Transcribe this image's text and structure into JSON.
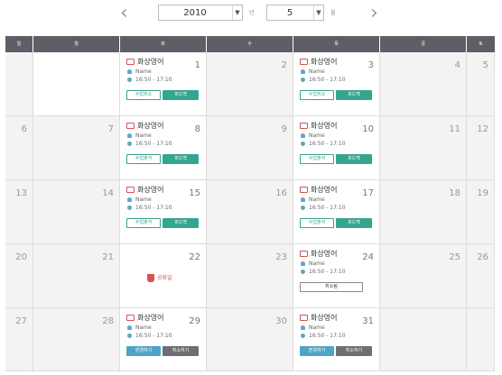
{
  "nav": {
    "prev_icon": "‹",
    "next_icon": "›"
  },
  "year_select": {
    "value": "2010",
    "unit": "년"
  },
  "month_select": {
    "value": "5",
    "unit": "월"
  },
  "weekdays": [
    "일",
    "월",
    "화",
    "수",
    "목",
    "금",
    "토"
  ],
  "rows": [
    {
      "days": [
        {
          "num": "",
          "gray": true
        },
        {
          "num": "",
          "gray": false
        },
        {
          "num": "1",
          "gray": false,
          "lesson": {
            "title": "화상영어",
            "teacher": "Name",
            "time": "16:50 - 17:10",
            "buttons": [
              {
                "label": "수업취소",
                "style": "outline"
              },
              {
                "label": "피드백",
                "style": "teal"
              }
            ]
          }
        },
        {
          "num": "2",
          "gray": true
        },
        {
          "num": "3",
          "gray": false,
          "lesson": {
            "title": "화상영어",
            "teacher": "Name",
            "time": "16:50 - 17:10",
            "buttons": [
              {
                "label": "수업취소",
                "style": "outline"
              },
              {
                "label": "피드백",
                "style": "teal"
              }
            ]
          }
        },
        {
          "num": "4",
          "gray": true
        },
        {
          "num": "5",
          "gray": true
        }
      ]
    },
    {
      "days": [
        {
          "num": "6",
          "gray": true
        },
        {
          "num": "7",
          "gray": true
        },
        {
          "num": "8",
          "gray": false,
          "lesson": {
            "title": "화상영어",
            "teacher": "Name",
            "time": "16:50 - 17:10",
            "buttons": [
              {
                "label": "수업출석",
                "style": "outline"
              },
              {
                "label": "피드백",
                "style": "teal"
              }
            ]
          }
        },
        {
          "num": "9",
          "gray": true
        },
        {
          "num": "10",
          "gray": false,
          "lesson": {
            "title": "화상영어",
            "teacher": "Name",
            "time": "16:50 - 17:10",
            "buttons": [
              {
                "label": "수업출석",
                "style": "outline"
              },
              {
                "label": "피드백",
                "style": "teal"
              }
            ]
          }
        },
        {
          "num": "11",
          "gray": true
        },
        {
          "num": "12",
          "gray": true
        }
      ]
    },
    {
      "days": [
        {
          "num": "13",
          "gray": true
        },
        {
          "num": "14",
          "gray": true
        },
        {
          "num": "15",
          "gray": false,
          "lesson": {
            "title": "화상영어",
            "teacher": "Name",
            "time": "16:50 - 17:10",
            "buttons": [
              {
                "label": "수업출석",
                "style": "outline"
              },
              {
                "label": "피드백",
                "style": "teal"
              }
            ]
          }
        },
        {
          "num": "16",
          "gray": true
        },
        {
          "num": "17",
          "gray": false,
          "lesson": {
            "title": "화상영어",
            "teacher": "Name",
            "time": "16:50 - 17:10",
            "buttons": [
              {
                "label": "수업출석",
                "style": "outline"
              },
              {
                "label": "피드백",
                "style": "teal"
              }
            ]
          }
        },
        {
          "num": "18",
          "gray": true
        },
        {
          "num": "19",
          "gray": true
        }
      ]
    },
    {
      "days": [
        {
          "num": "20",
          "gray": true
        },
        {
          "num": "21",
          "gray": true
        },
        {
          "num": "22",
          "gray": false,
          "holiday": "공휴일"
        },
        {
          "num": "23",
          "gray": true
        },
        {
          "num": "24",
          "gray": false,
          "lesson": {
            "title": "화상영어",
            "teacher": "Name",
            "time": "16:50 - 17:10",
            "buttons": [
              {
                "label": "취소됨",
                "style": "wide"
              }
            ]
          }
        },
        {
          "num": "25",
          "gray": true
        },
        {
          "num": "26",
          "gray": true
        }
      ]
    },
    {
      "days": [
        {
          "num": "27",
          "gray": true
        },
        {
          "num": "28",
          "gray": true
        },
        {
          "num": "29",
          "gray": false,
          "lesson": {
            "title": "화상영어",
            "teacher": "Name",
            "time": "16:50 - 17:10",
            "buttons": [
              {
                "label": "변경하기",
                "style": "blue"
              },
              {
                "label": "취소하기",
                "style": "dark"
              }
            ]
          }
        },
        {
          "num": "30",
          "gray": true
        },
        {
          "num": "31",
          "gray": false,
          "lesson": {
            "title": "화상영어",
            "teacher": "Name",
            "time": "16:50 - 17:10",
            "buttons": [
              {
                "label": "변경하기",
                "style": "blue"
              },
              {
                "label": "취소하기",
                "style": "dark"
              }
            ]
          }
        },
        {
          "num": "",
          "gray": true
        },
        {
          "num": "",
          "gray": true
        }
      ]
    }
  ]
}
